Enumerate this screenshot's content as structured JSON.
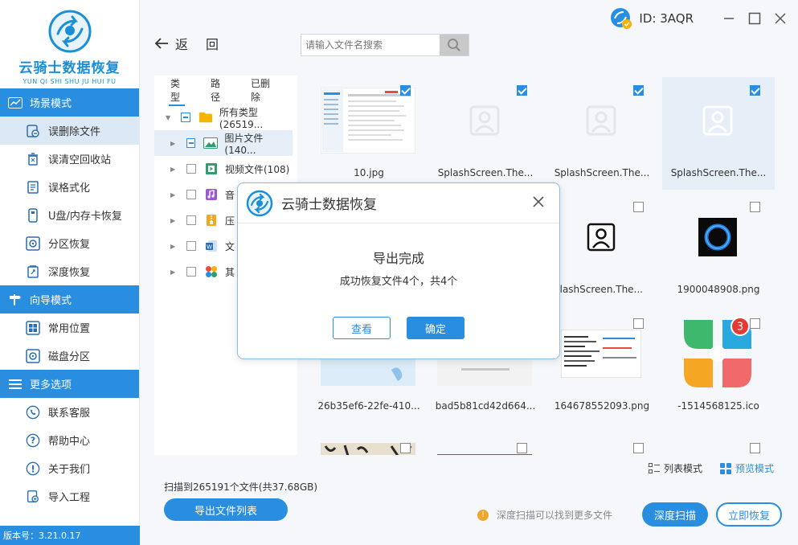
{
  "app": {
    "name": "云骑士数据恢复",
    "subtitle": "YUN QI SHI SHU JU HUI FU",
    "version": "版本号：3.21.0.17",
    "user_id": "ID: 3AQR",
    "accent": "#2a8ee0"
  },
  "sidebar": {
    "sections": [
      {
        "title": "场景模式",
        "items": [
          {
            "label": "误删除文件",
            "icon": "deleted-file-icon",
            "active": true
          },
          {
            "label": "误清空回收站",
            "icon": "recycle-bin-icon"
          },
          {
            "label": "误格式化",
            "icon": "format-icon"
          },
          {
            "label": "U盘/内存卡恢复",
            "icon": "usb-drive-icon"
          },
          {
            "label": "分区恢复",
            "icon": "partition-icon"
          },
          {
            "label": "深度恢复",
            "icon": "deep-recovery-icon"
          }
        ]
      },
      {
        "title": "向导模式",
        "items": [
          {
            "label": "常用位置",
            "icon": "windows-icon"
          },
          {
            "label": "磁盘分区",
            "icon": "disk-icon"
          }
        ]
      },
      {
        "title": "更多选项",
        "items": [
          {
            "label": "联系客服",
            "icon": "phone-icon"
          },
          {
            "label": "帮助中心",
            "icon": "help-icon"
          },
          {
            "label": "关于我们",
            "icon": "info-icon"
          },
          {
            "label": "导入工程",
            "icon": "import-icon"
          }
        ]
      }
    ]
  },
  "toolbar": {
    "back_label": "返",
    "up_label": "回",
    "search_placeholder": "请输入文件名搜索"
  },
  "tree": {
    "tabs": [
      "类型",
      "路径",
      "已删除"
    ],
    "root": "所有类型(26519...",
    "items": [
      {
        "label": "图片文件(140...",
        "icon": "image-file-icon",
        "selected": true
      },
      {
        "label": "视频文件(108)",
        "icon": "video-file-icon"
      },
      {
        "label": "音",
        "icon": "audio-file-icon"
      },
      {
        "label": "压",
        "icon": "archive-file-icon"
      },
      {
        "label": "文",
        "icon": "document-file-icon"
      },
      {
        "label": "其",
        "icon": "other-file-icon"
      }
    ]
  },
  "files": [
    {
      "name": "10.jpg",
      "checked": true,
      "thumb": "screenshot"
    },
    {
      "name": "SplashScreen.The...",
      "checked": true,
      "thumb": "placeholder"
    },
    {
      "name": "SplashScreen.The...",
      "checked": true,
      "thumb": "placeholder"
    },
    {
      "name": "SplashScreen.The...",
      "checked": true,
      "thumb": "placeholder",
      "highlight": true
    },
    {
      "name": "",
      "checked": false,
      "thumb": "hidden"
    },
    {
      "name": "",
      "checked": false,
      "thumb": "hidden"
    },
    {
      "name": "plashScreen.The...",
      "checked": false,
      "thumb": "user"
    },
    {
      "name": "1900048908.png",
      "checked": false,
      "thumb": "ring"
    },
    {
      "name": "26b35ef6-22fe-410...",
      "checked": false,
      "thumb": "lightblue"
    },
    {
      "name": "bad5b81cd42d664...",
      "checked": false,
      "thumb": "lightgray"
    },
    {
      "name": "164678552093.png",
      "checked": false,
      "thumb": "doc"
    },
    {
      "name": "-1514568125.ico",
      "checked": false,
      "thumb": "flower",
      "badge": "3"
    },
    {
      "name": "",
      "checked": false,
      "thumb": "calligraphy"
    },
    {
      "name": "",
      "checked": false,
      "thumb": "bluebar"
    },
    {
      "name": "",
      "checked": false,
      "thumb": "blank"
    },
    {
      "name": "",
      "checked": false,
      "thumb": "blank"
    }
  ],
  "view_modes": {
    "list": "列表模式",
    "preview": "预览模式"
  },
  "status": {
    "scan_text": "扫描到265191个文件(共37.68GB)",
    "export_label": "导出文件列表",
    "hint": "深度扫描可以找到更多文件",
    "deep_scan_label": "深度扫描",
    "recover_label": "立即恢复"
  },
  "dialog": {
    "title": "云骑士数据恢复",
    "message": "导出完成",
    "detail": "成功恢复文件4个，共4个",
    "view_label": "查看",
    "ok_label": "确定"
  }
}
